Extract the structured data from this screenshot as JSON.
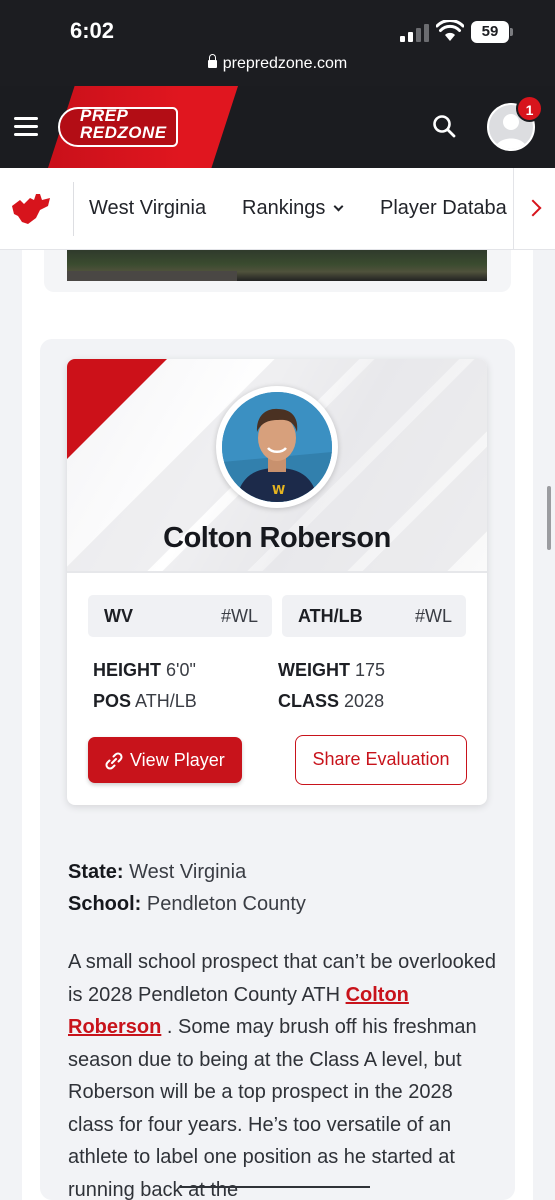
{
  "status_bar": {
    "time": "6:02",
    "battery": "59",
    "url": "prepredzone.com"
  },
  "header": {
    "logo_line1": "PREP",
    "logo_line2": "REDZONE",
    "notification_count": "1"
  },
  "subnav": {
    "items": [
      {
        "label": "West Virginia"
      },
      {
        "label": "Rankings"
      },
      {
        "label": "Player Databa"
      }
    ]
  },
  "player": {
    "name": "Colton Roberson",
    "tags": [
      {
        "left": "WV",
        "right": "#WL"
      },
      {
        "left": "ATH/LB",
        "right": "#WL"
      }
    ],
    "stats": {
      "height_label": "HEIGHT",
      "height": "6'0\"",
      "weight_label": "WEIGHT",
      "weight": "175",
      "pos_label": "POS",
      "pos": "ATH/LB",
      "class_label": "CLASS",
      "class": "2028"
    },
    "view_button": "View Player",
    "share_button": "Share Evaluation"
  },
  "article": {
    "state_label": "State:",
    "state": "West Virginia",
    "school_label": "School:",
    "school": "Pendleton County",
    "para_before": "A small school prospect that can’t be overlooked is 2028 Pendleton County ATH ",
    "para_link": "Colton Roberson",
    "para_after": " . Some may brush off his freshman season due to being at the Class A level, but Roberson will be a top prospect in the 2028 class for four years. He’s too versatile of an athlete to label one position as he started at running back at the"
  },
  "colors": {
    "brand_red": "#d7141c",
    "header_dark": "#1b1c20"
  }
}
